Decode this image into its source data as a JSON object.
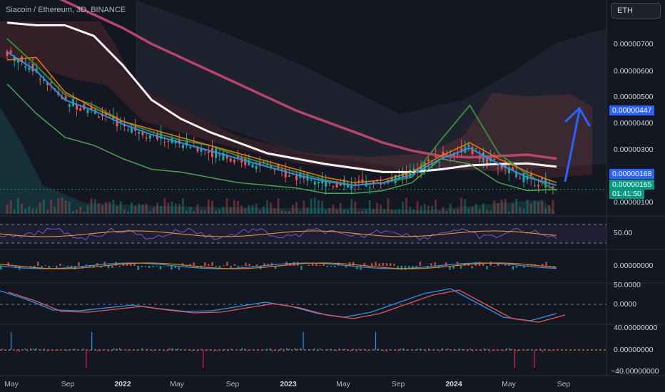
{
  "header": {
    "title": "Siacoin / Ethereum, 3D, BINANCE",
    "currency_button": "ETH"
  },
  "colors": {
    "background": "#131722",
    "up": "#26a69a",
    "down": "#ef5350",
    "sma_white": "#ffffff",
    "sma_pink": "#c2466f",
    "ma_green": "#4caf50",
    "ma_orange": "#f57c00",
    "ma_blue": "#2196f3",
    "conv_green": "#388e3c",
    "arrow": "#2962ff",
    "price_line": "#089981"
  },
  "price_axis": {
    "ticks": [
      "0.00000700",
      "0.00000600",
      "0.00000500",
      "0.00000400",
      "0.00000300",
      "0.00000100"
    ],
    "marker_high": "0.00000447",
    "marker_mid": "0.00000168",
    "current_price": "0.00000165",
    "countdown": "01:41:50"
  },
  "panes": {
    "rsi": {
      "label": "50.00"
    },
    "macd": {
      "label": "0.00000000"
    },
    "osc": {
      "labels": [
        "50.0000",
        "0.0000"
      ]
    },
    "spike": {
      "labels": [
        "40.00000000",
        "0.00000000",
        "−40.00000000"
      ]
    }
  },
  "time_axis": [
    {
      "label": "May",
      "bold": false
    },
    {
      "label": "Sep",
      "bold": false
    },
    {
      "label": "2022",
      "bold": true
    },
    {
      "label": "May",
      "bold": false
    },
    {
      "label": "Sep",
      "bold": false
    },
    {
      "label": "2023",
      "bold": true
    },
    {
      "label": "May",
      "bold": false
    },
    {
      "label": "Sep",
      "bold": false
    },
    {
      "label": "2024",
      "bold": true
    },
    {
      "label": "May",
      "bold": false
    },
    {
      "label": "Sep",
      "bold": false
    }
  ],
  "chart_data": {
    "type": "line",
    "series": [
      {
        "values": [
          7.9,
          7.8,
          7.8,
          7.4,
          6.3,
          5.0,
          4.3,
          3.8,
          3.4,
          3.0,
          2.8,
          2.6,
          2.45,
          2.3,
          2.3,
          2.4,
          2.55,
          2.6,
          2.62,
          2.5
        ]
      },
      {
        "values": [
          9.6,
          9.2,
          8.7,
          8.2,
          7.7,
          7.1,
          6.6,
          6.1,
          5.6,
          5.1,
          4.6,
          4.2,
          3.8,
          3.4,
          3.1,
          2.9,
          2.85,
          2.9,
          2.95,
          2.8
        ]
      },
      {
        "values": [
          7.3,
          6.3,
          5.2,
          4.8,
          4.2,
          3.8,
          3.5,
          3.3,
          2.9,
          2.6,
          2.3,
          2.0,
          1.8,
          1.9,
          2.1,
          3.5,
          4.8,
          3.0,
          2.2,
          1.6
        ]
      },
      {
        "values": [
          6.8,
          6.1,
          5.0,
          4.6,
          4.1,
          3.7,
          3.4,
          3.1,
          2.8,
          2.5,
          2.2,
          1.95,
          1.8,
          1.9,
          2.2,
          2.8,
          3.2,
          2.6,
          2.1,
          1.8
        ]
      },
      {
        "values": [
          6.5,
          6.6,
          5.3,
          4.7,
          4.2,
          3.9,
          3.6,
          3.3,
          3.0,
          2.7,
          2.4,
          2.1,
          1.9,
          2.0,
          2.3,
          2.9,
          3.4,
          2.8,
          2.3,
          1.9
        ]
      },
      {
        "values": [
          5.6,
          4.5,
          3.6,
          3.3,
          2.8,
          2.4,
          2.3,
          2.1,
          1.9,
          1.8,
          1.7,
          1.5,
          1.5,
          1.6,
          1.9,
          2.8,
          2.6,
          1.9,
          1.6,
          1.65
        ]
      }
    ],
    "ylim": [
      1,
      8
    ]
  }
}
